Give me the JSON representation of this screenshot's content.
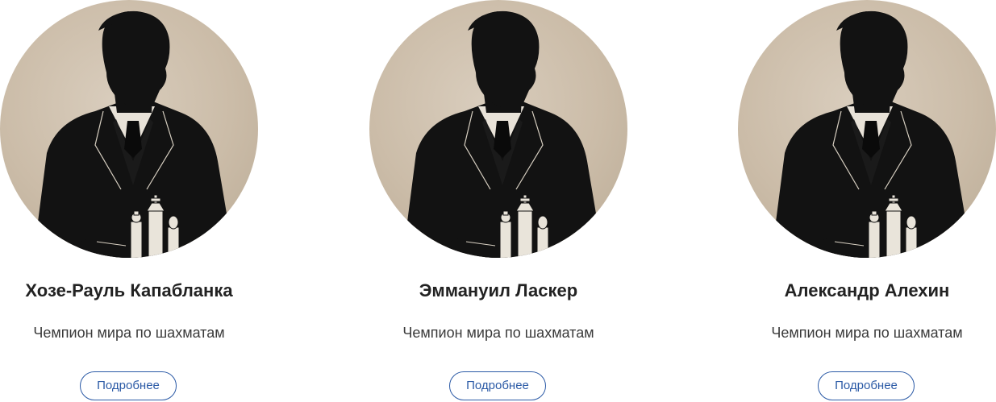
{
  "colors": {
    "portrait_bg": "#cbbca8",
    "silhouette": "#121212",
    "button_accent": "#2b5aa6"
  },
  "cards": [
    {
      "name": "Хозе-Рауль Капабланка",
      "subtitle": "Чемпион мира по шахматам",
      "button_label": "Подробнее",
      "image_icon": "chess-player-silhouette"
    },
    {
      "name": "Эммануил Ласкер",
      "subtitle": "Чемпион мира по шахматам",
      "button_label": "Подробнее",
      "image_icon": "chess-player-silhouette"
    },
    {
      "name": "Александр Алехин",
      "subtitle": "Чемпион мира по шахматам",
      "button_label": "Подробнее",
      "image_icon": "chess-player-silhouette"
    }
  ]
}
